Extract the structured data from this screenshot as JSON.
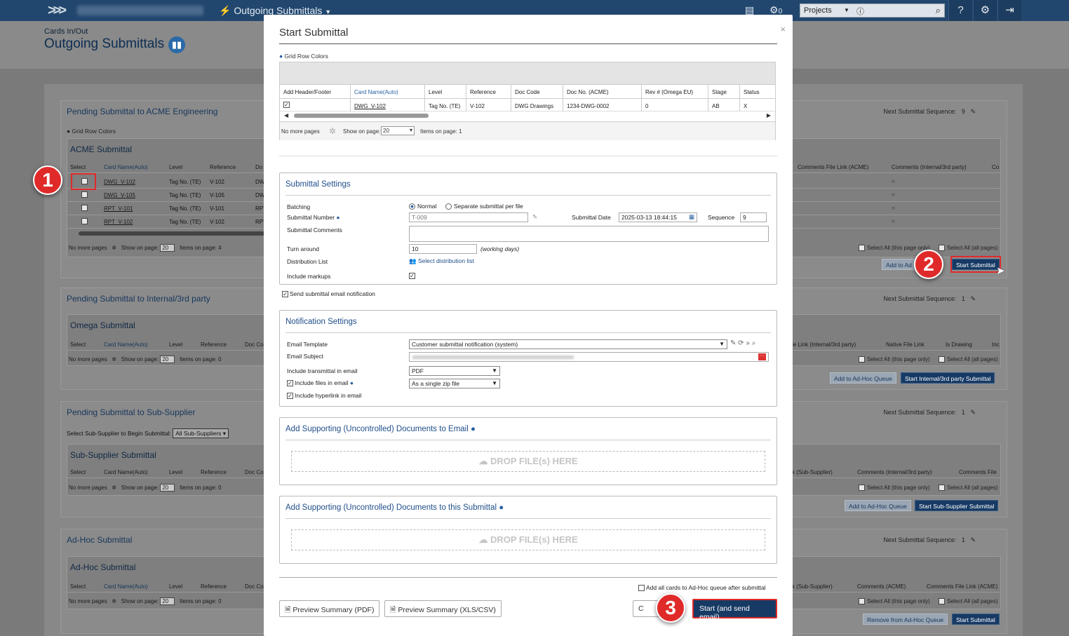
{
  "topbar": {
    "breadcrumb": "Outgoing Submittals",
    "notif_count": "0",
    "projects_label": "Projects"
  },
  "page": {
    "subtitle": "Cards In/Out",
    "title": "Outgoing Submittals"
  },
  "background": {
    "next_seq_label": "Next Submittal Sequence:",
    "pager_no_more": "No more pages",
    "pager_show": "Show on page:",
    "pager_size": "20",
    "select_all_page": "Select All (this page only)",
    "select_all_all": "Select All (all pages)",
    "panel1": {
      "title": "Pending Submittal to ACME Engineering",
      "seq": "9",
      "grid_row_colors": "Grid Row Colors",
      "table_title": "ACME Submittal",
      "cols": [
        "Select",
        "Card Name(Auto)",
        "Level",
        "Reference",
        "Do"
      ],
      "right_cols": [
        "Comments File Link (ACME)",
        "Comments (Internal/3rd party)",
        "Co"
      ],
      "rows": [
        {
          "name": "DWG_V-102",
          "level": "Tag No. (TE)",
          "ref": "V-102",
          "doc": "DW"
        },
        {
          "name": "DWG_V-105",
          "level": "Tag No. (TE)",
          "ref": "V-105",
          "doc": "DW"
        },
        {
          "name": "RPT_V-101",
          "level": "Tag No. (TE)",
          "ref": "V-101",
          "doc": "RPT"
        },
        {
          "name": "RPT_V-102",
          "level": "Tag No. (TE)",
          "ref": "V-102",
          "doc": "RPT"
        }
      ],
      "items": "Items on page: 4",
      "btn_queue": "Add to Ad",
      "btn_start": "Start Submittal"
    },
    "panel2": {
      "title": "Pending Submittal to Internal/3rd party",
      "seq": "1",
      "table_title": "Omega Submittal",
      "cols": [
        "Select",
        "Card Name(Auto)",
        "Level",
        "Reference",
        "Doc Co"
      ],
      "right_cols": [
        "le Link (Internal/3rd party)",
        "Native File Link",
        "Is Drawing",
        "Inc"
      ],
      "items": "Items on page: 0",
      "btn_queue": "Add to Ad-Hoc Queue",
      "btn_start": "Start Internal/3rd party Submittal"
    },
    "panel3": {
      "title": "Pending Submittal to Sub-Supplier",
      "seq": "1",
      "select_label": "Select Sub-Supplier to Begin Submittal:",
      "select_value": "All Sub-Suppliers",
      "table_title": "Sub-Supplier Submittal",
      "cols": [
        "Select",
        "Card Name(Auto)",
        "Level",
        "Reference",
        "Doc Co"
      ],
      "right_cols": [
        "k (Sub-Supplier)",
        "Comments (Internal/3rd party)",
        "Comments File"
      ],
      "items": "Items on page: 0",
      "btn_queue": "Add to Ad-Hoc Queue",
      "btn_start": "Start Sub-Supplier Submittal"
    },
    "panel4": {
      "title": "Ad-Hoc Submittal",
      "seq": "1",
      "table_title": "Ad-Hoc Submittal",
      "cols": [
        "Select",
        "Card Name(Auto)",
        "Level",
        "Reference",
        "Doc Co"
      ],
      "right_cols": [
        "k (Sub-Supplier)",
        "Comments (ACME)",
        "Comments File Link (ACME)"
      ],
      "items": "Items on page: 0",
      "btn_queue": "Remove from Ad-Hoc Queue",
      "btn_start": "Start Submittal"
    }
  },
  "modal": {
    "title": "Start Submittal",
    "close": "×",
    "grid_row_colors": "Grid Row Colors",
    "grid": {
      "columns": [
        "Add Header/Footer",
        "Card Name(Auto)",
        "Level",
        "Reference",
        "Doc Code",
        "Doc No. (ACME)",
        "Rev # (Omega EU)",
        "Stage",
        "Status"
      ],
      "row": {
        "name": "DWG_V-102",
        "level": "Tag No. (TE)",
        "ref": "V-102",
        "doc_code": "DWG Drawings",
        "doc_no": "1234-DWG-0002",
        "rev": "0",
        "stage": "AB",
        "status": "X"
      },
      "pager_no_more": "No more pages",
      "pager_show": "Show on page:",
      "pager_size": "20",
      "items": "Items on page: 1"
    },
    "settings": {
      "title": "Submittal Settings",
      "batching_label": "Batching",
      "batching_normal": "Normal",
      "batching_separate": "Separate submittal per file",
      "number_label": "Submittal Number",
      "number_value": "T-009",
      "date_label": "Submittal Date",
      "date_value": "2025-03-13 18:44:15",
      "sequence_label": "Sequence",
      "sequence_value": "9",
      "comments_label": "Submittal Comments",
      "turnaround_label": "Turn around",
      "turnaround_value": "10",
      "turnaround_unit": "(working days)",
      "distribution_label": "Distribution List",
      "distribution_link": "Select distribution list",
      "markups_label": "Include markups"
    },
    "send_email_label": "Send submittal email notification",
    "notification": {
      "title": "Notification Settings",
      "template_label": "Email Template",
      "template_value": "Customer submittal notification (system)",
      "subject_label": "Email Subject",
      "transmittal_label": "Include transmittal in email",
      "transmittal_value": "PDF",
      "files_label": "Include files in email",
      "files_value": "As a single zip file",
      "hyperlink_label": "Include hyperlink in email"
    },
    "support_email": {
      "title": "Add Supporting (Uncontrolled) Documents to Email",
      "drop": "DROP FILE(s) HERE"
    },
    "support_submittal": {
      "title": "Add Supporting (Uncontrolled) Documents to this Submittal",
      "drop": "DROP FILE(s) HERE"
    },
    "adhoc_label": "Add all cards to Ad-Hoc queue after submittal",
    "btn_preview_pdf": "Preview Summary (PDF)",
    "btn_preview_xls": "Preview Summary (XLS/CSV)",
    "btn_cancel": "C",
    "btn_start": "Start (and send email)"
  },
  "annotations": {
    "step1": "1",
    "step2": "2",
    "step3": "3"
  },
  "colors": {
    "topbar": "#22476e",
    "accent": "#1f4e8a",
    "primary_button": "#173a64",
    "annotation_red": "#e02a2a"
  }
}
